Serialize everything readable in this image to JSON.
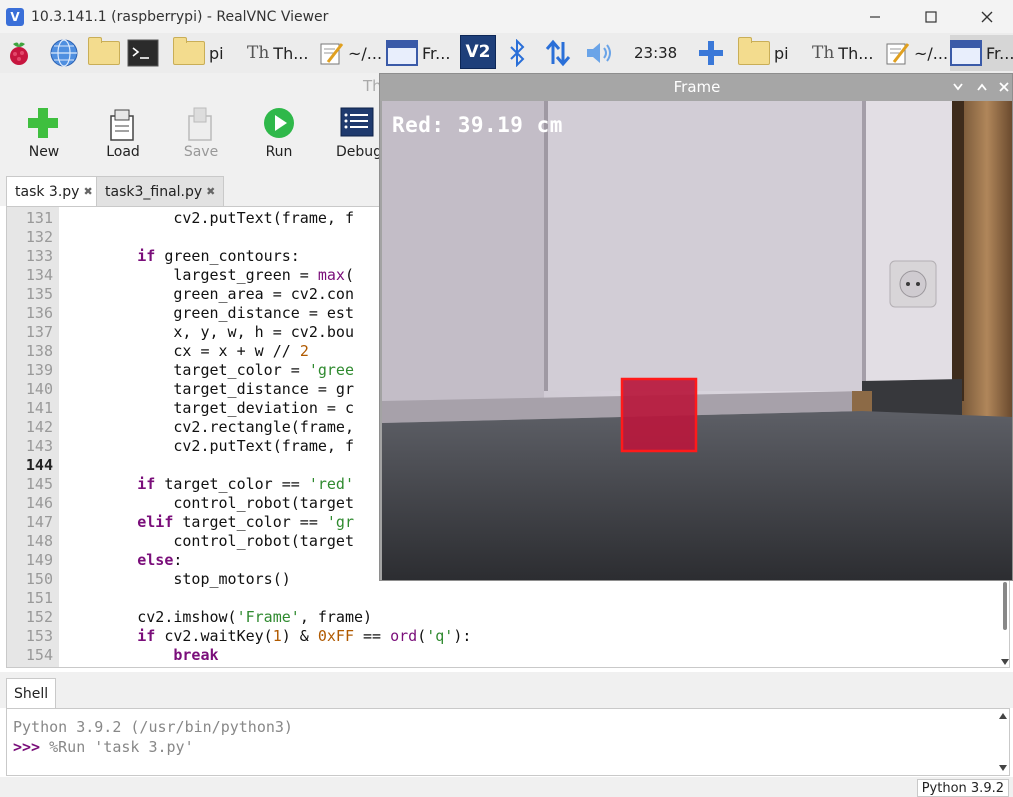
{
  "vnc": {
    "title": "10.3.141.1 (raspberrypi) - RealVNC Viewer"
  },
  "panel": {
    "items": [
      {
        "label": "pi"
      },
      {
        "label": "Th..."
      },
      {
        "label": "~/..."
      },
      {
        "label": "Fr..."
      }
    ],
    "clock": "23:38",
    "items_right": [
      {
        "label": "pi"
      },
      {
        "label": "Th..."
      },
      {
        "label": "~/..."
      },
      {
        "label": "Fr..."
      }
    ]
  },
  "thonny": {
    "title_fragment": "Th",
    "toolbar": {
      "new": "New",
      "load": "Load",
      "save": "Save",
      "run": "Run",
      "debug": "Debug"
    },
    "tabs": [
      {
        "label": "task 3.py"
      },
      {
        "label": "task3_final.py"
      }
    ],
    "editor": {
      "current_line": 144,
      "lines": [
        {
          "n": "131",
          "text": "            cv2.putText(frame, f"
        },
        {
          "n": "132",
          "text": ""
        },
        {
          "n": "133",
          "text": "        if green_contours:"
        },
        {
          "n": "134",
          "text": "            largest_green = max("
        },
        {
          "n": "135",
          "text": "            green_area = cv2.con"
        },
        {
          "n": "136",
          "text": "            green_distance = est"
        },
        {
          "n": "137",
          "text": "            x, y, w, h = cv2.bou"
        },
        {
          "n": "138",
          "text": "            cx = x + w // 2"
        },
        {
          "n": "139",
          "text": "            target_color = 'gree"
        },
        {
          "n": "140",
          "text": "            target_distance = gr"
        },
        {
          "n": "141",
          "text": "            target_deviation = c"
        },
        {
          "n": "142",
          "text": "            cv2.rectangle(frame,"
        },
        {
          "n": "143",
          "text": "            cv2.putText(frame, f"
        },
        {
          "n": "144",
          "text": ""
        },
        {
          "n": "145",
          "text": "        if target_color == 'red'"
        },
        {
          "n": "146",
          "text": "            control_robot(target"
        },
        {
          "n": "147",
          "text": "        elif target_color == 'gr"
        },
        {
          "n": "148",
          "text": "            control_robot(target"
        },
        {
          "n": "149",
          "text": "        else:"
        },
        {
          "n": "150",
          "text": "            stop_motors()"
        },
        {
          "n": "151",
          "text": ""
        },
        {
          "n": "152",
          "text": "        cv2.imshow('Frame', frame)"
        },
        {
          "n": "153",
          "text": "        if cv2.waitKey(1) & 0xFF == ord('q'):"
        },
        {
          "n": "154",
          "text": "            break"
        }
      ]
    },
    "shell": {
      "tab": "Shell",
      "version_line": "Python 3.9.2 (/usr/bin/python3)",
      "prompt": ">>>",
      "command": " %Run 'task 3.py'"
    },
    "status": {
      "interpreter": "Python 3.9.2"
    }
  },
  "frame": {
    "title": "Frame",
    "overlay_text": "Red: 39.19 cm",
    "box_color": "#ff1a1a"
  }
}
